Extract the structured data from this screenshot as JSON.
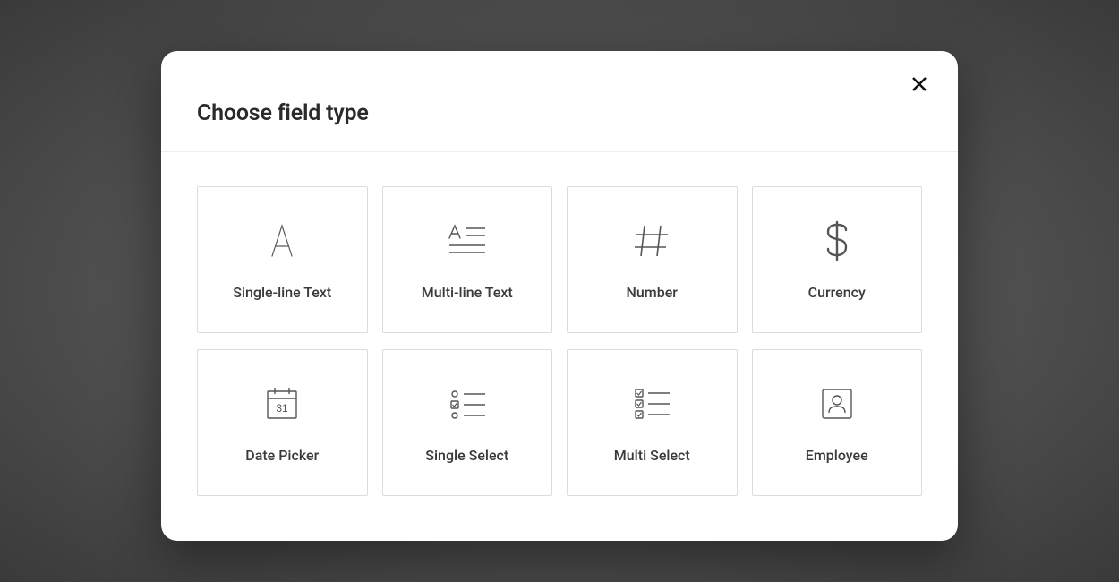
{
  "modal": {
    "title": "Choose field type",
    "options": [
      {
        "id": "single-line-text",
        "label": "Single-line Text",
        "icon": "letter-a-icon"
      },
      {
        "id": "multi-line-text",
        "label": "Multi-line Text",
        "icon": "multiline-text-icon"
      },
      {
        "id": "number",
        "label": "Number",
        "icon": "hash-icon"
      },
      {
        "id": "currency",
        "label": "Currency",
        "icon": "dollar-icon"
      },
      {
        "id": "date-picker",
        "label": "Date Picker",
        "icon": "calendar-icon"
      },
      {
        "id": "single-select",
        "label": "Single Select",
        "icon": "single-select-icon"
      },
      {
        "id": "multi-select",
        "label": "Multi Select",
        "icon": "multi-select-icon"
      },
      {
        "id": "employee",
        "label": "Employee",
        "icon": "employee-icon"
      }
    ],
    "calendar_day": "31"
  }
}
